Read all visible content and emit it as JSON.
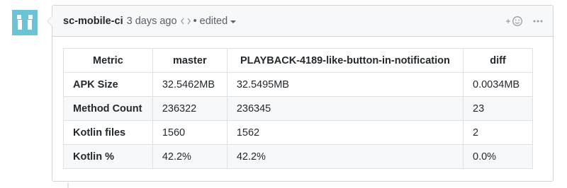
{
  "comment": {
    "author": "sc-mobile-ci",
    "timestamp": "3 days ago",
    "bullet": "•",
    "edited_label": "edited",
    "icons": {
      "avatar": "identicon-avatar",
      "code": "code-icon",
      "caret": "caret-down-icon",
      "reaction": "add-reaction-icon",
      "more": "kebab-horizontal-icon"
    },
    "colors": {
      "avatar": "#6cc3d5",
      "header_bg": "#f6f8fa",
      "border": "#d1d5da"
    }
  },
  "table": {
    "headers": [
      "Metric",
      "master",
      "PLAYBACK-4189-like-button-in-notification",
      "diff"
    ],
    "rows": [
      [
        "APK Size",
        "32.5462MB",
        "32.5495MB",
        "0.0034MB"
      ],
      [
        "Method Count",
        "236322",
        "236345",
        "23"
      ],
      [
        "Kotlin files",
        "1560",
        "1562",
        "2"
      ],
      [
        "Kotlin %",
        "42.2%",
        "42.2%",
        "0.0%"
      ]
    ]
  }
}
